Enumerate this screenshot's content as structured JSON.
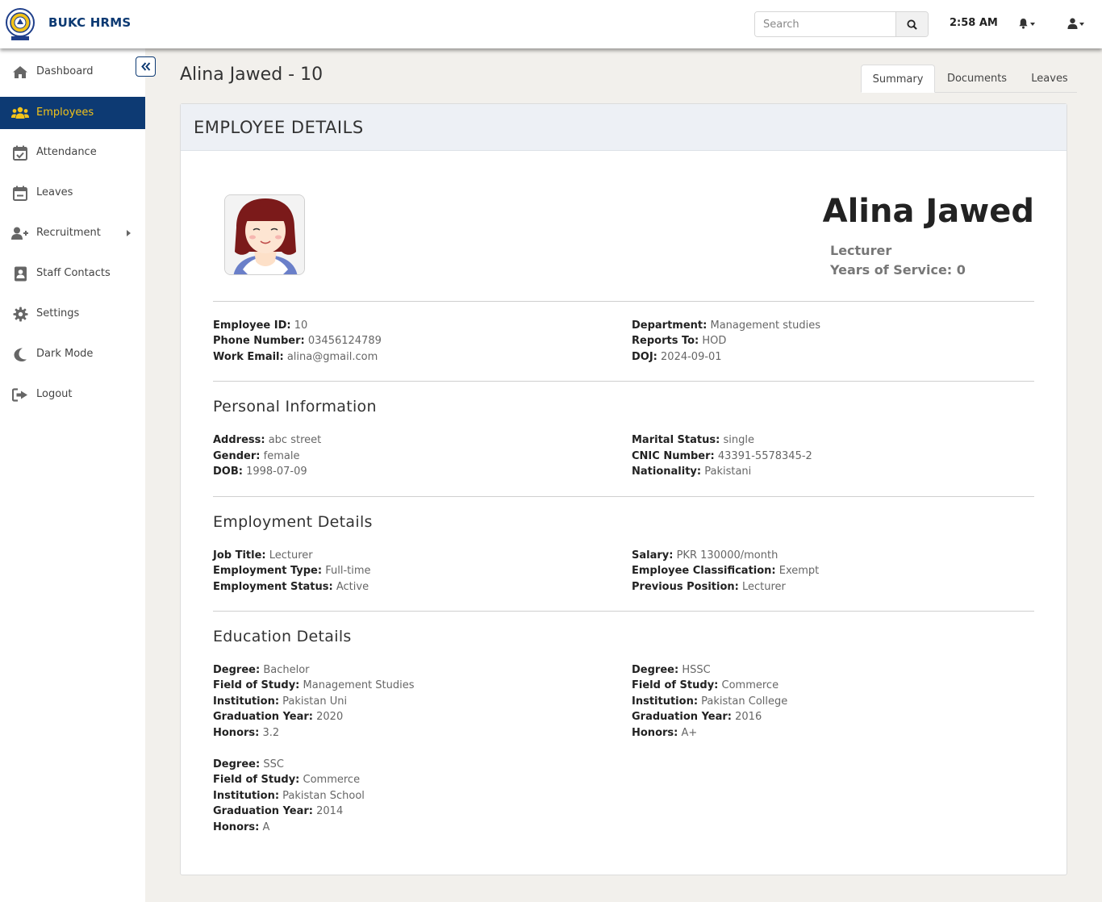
{
  "app": {
    "brand": "BUKC HRMS",
    "logo_text": "BAHRIA UNIVERSITY"
  },
  "topbar": {
    "search_placeholder": "Search",
    "time": "2:58 AM"
  },
  "colors": {
    "brand_navy": "#0d3a73",
    "active_text": "#f3c319",
    "page_bg": "#f2f0ec",
    "header_bg": "#edf0f5"
  },
  "sidebar": {
    "items": [
      {
        "label": "Dashboard",
        "icon": "home-icon"
      },
      {
        "label": "Employees",
        "icon": "users-icon",
        "active": true
      },
      {
        "label": "Attendance",
        "icon": "calendar-check-icon"
      },
      {
        "label": "Leaves",
        "icon": "calendar-minus-icon"
      },
      {
        "label": "Recruitment",
        "icon": "user-plus-icon",
        "has_submenu": true
      },
      {
        "label": "Staff Contacts",
        "icon": "address-book-icon"
      },
      {
        "label": "Settings",
        "icon": "gear-icon"
      },
      {
        "label": "Dark Mode",
        "icon": "moon-icon"
      },
      {
        "label": "Logout",
        "icon": "sign-out-icon"
      }
    ]
  },
  "page": {
    "title": "Alina Jawed - 10",
    "tabs": [
      "Summary",
      "Documents",
      "Leaves"
    ],
    "active_tab": "Summary"
  },
  "card": {
    "header": "EMPLOYEE DETAILS",
    "name": "Alina Jawed",
    "role": "Lecturer",
    "years_label": "Years of Service:",
    "years_value": "0"
  },
  "basic": {
    "left": [
      {
        "label": "Employee ID:",
        "value": "10"
      },
      {
        "label": "Phone Number:",
        "value": "03456124789"
      },
      {
        "label": "Work Email:",
        "value": "alina@gmail.com"
      }
    ],
    "right": [
      {
        "label": "Department:",
        "value": "Management studies"
      },
      {
        "label": "Reports To:",
        "value": "HOD"
      },
      {
        "label": "DOJ:",
        "value": "2024-09-01"
      }
    ]
  },
  "personal": {
    "title": "Personal Information",
    "left": [
      {
        "label": "Address:",
        "value": "abc street"
      },
      {
        "label": "Gender:",
        "value": "female"
      },
      {
        "label": "DOB:",
        "value": "1998-07-09"
      }
    ],
    "right": [
      {
        "label": "Marital Status:",
        "value": "single"
      },
      {
        "label": "CNIC Number:",
        "value": "43391-5578345-2"
      },
      {
        "label": "Nationality:",
        "value": "Pakistani"
      }
    ]
  },
  "employment": {
    "title": "Employment Details",
    "left": [
      {
        "label": "Job Title:",
        "value": "Lecturer"
      },
      {
        "label": "Employment Type:",
        "value": "Full-time"
      },
      {
        "label": "Employment Status:",
        "value": "Active"
      }
    ],
    "right": [
      {
        "label": "Salary:",
        "value": "PKR 130000/month"
      },
      {
        "label": "Employee Classification:",
        "value": "Exempt"
      },
      {
        "label": "Previous Position:",
        "value": "Lecturer"
      }
    ]
  },
  "education": {
    "title": "Education Details",
    "entries": [
      [
        {
          "label": "Degree:",
          "value": "Bachelor"
        },
        {
          "label": "Field of Study:",
          "value": "Management Studies"
        },
        {
          "label": "Institution:",
          "value": "Pakistan Uni"
        },
        {
          "label": "Graduation Year:",
          "value": "2020"
        },
        {
          "label": "Honors:",
          "value": "3.2"
        }
      ],
      [
        {
          "label": "Degree:",
          "value": "HSSC"
        },
        {
          "label": "Field of Study:",
          "value": "Commerce"
        },
        {
          "label": "Institution:",
          "value": "Pakistan College"
        },
        {
          "label": "Graduation Year:",
          "value": "2016"
        },
        {
          "label": "Honors:",
          "value": "A+"
        }
      ],
      [
        {
          "label": "Degree:",
          "value": "SSC"
        },
        {
          "label": "Field of Study:",
          "value": "Commerce"
        },
        {
          "label": "Institution:",
          "value": "Pakistan School"
        },
        {
          "label": "Graduation Year:",
          "value": "2014"
        },
        {
          "label": "Honors:",
          "value": "A"
        }
      ]
    ]
  }
}
